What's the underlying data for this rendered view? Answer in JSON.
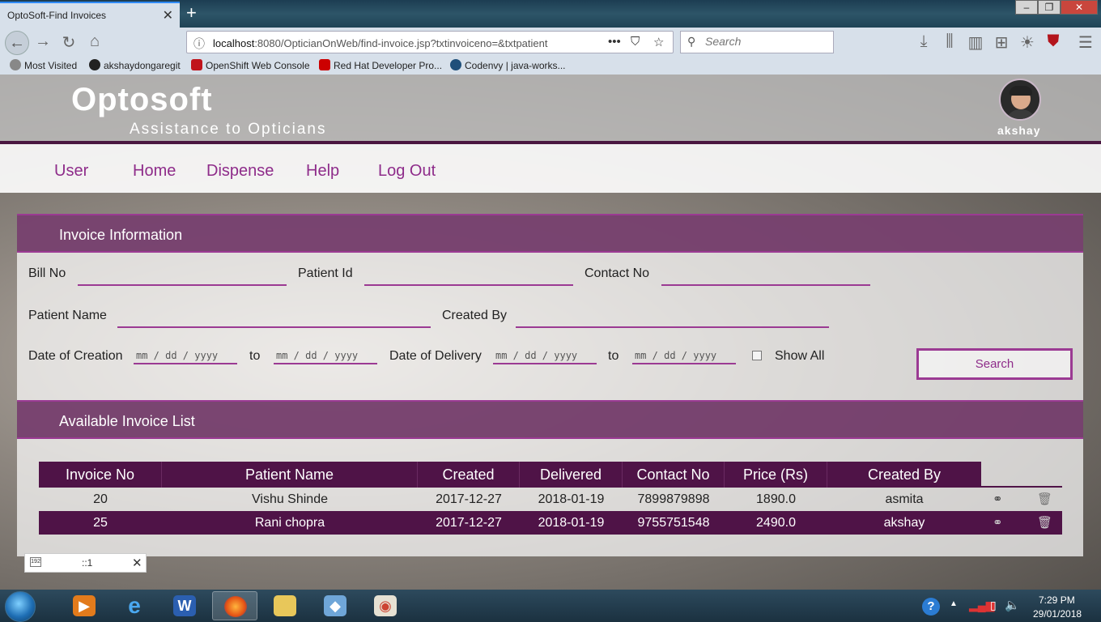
{
  "browser": {
    "tab_title": "OptoSoft-Find Invoices",
    "url_host": "localhost",
    "url_path": ":8080/OpticianOnWeb/find-invoice.jsp?txtinvoiceno=&txtpatient",
    "search_placeholder": "Search",
    "bookmarks": [
      "Most Visited",
      "akshaydongaregit",
      "OpenShift Web Console",
      "Red Hat Developer Pro...",
      "Codenvy | java-works..."
    ]
  },
  "header": {
    "brand": "Optosoft",
    "tagline": "Assistance to Opticians",
    "username": "akshay"
  },
  "menu": [
    "User",
    "Home",
    "Dispense",
    "Help",
    "Log Out"
  ],
  "invoice_info": {
    "heading": "Invoice Information",
    "bill_no_label": "Bill No",
    "patient_id_label": "Patient Id",
    "contact_no_label": "Contact No",
    "patient_name_label": "Patient Name",
    "created_by_label": "Created By",
    "date_creation_label": "Date of Creation",
    "to_label": "to",
    "date_delivery_label": "Date of Delivery",
    "date_placeholder": "mm / dd / yyyy",
    "show_all_label": "Show All",
    "search_button": "Search"
  },
  "invoice_list": {
    "heading": "Available Invoice List",
    "columns": [
      "Invoice No",
      "Patient Name",
      "Created",
      "Delivered",
      "Contact No",
      "Price (Rs)",
      "Created By"
    ],
    "rows": [
      [
        "20",
        "Vishu Shinde",
        "2017-12-27",
        "2018-01-19",
        "7899879898",
        "1890.0",
        "asmita"
      ],
      [
        "25",
        "Rani chopra",
        "2017-12-27",
        "2018-01-19",
        "9755751548",
        "2490.0",
        "akshay"
      ]
    ]
  },
  "notification": {
    "text": "::1"
  },
  "taskbar": {
    "time": "7:29 PM",
    "date": "29/01/2018"
  }
}
